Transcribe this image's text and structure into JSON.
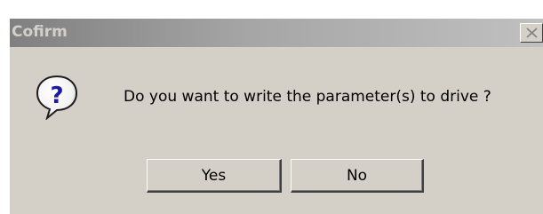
{
  "dialog": {
    "title": "Cofirm",
    "message": "Do you want to write the parameter(s) to drive ?",
    "icon": "question-icon",
    "icon_glyph": "?",
    "buttons": {
      "yes_label": "Yes",
      "no_label": "No"
    },
    "colors": {
      "face": "#d4d0c8",
      "titlebar_start": "#808080",
      "titlebar_end": "#c0c0c0",
      "icon_glyph": "#1a1aa8"
    }
  }
}
